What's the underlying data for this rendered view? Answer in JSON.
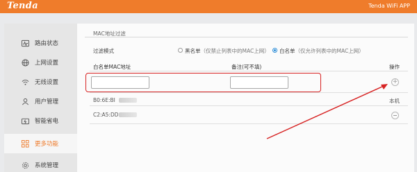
{
  "header": {
    "brand": "Tenda",
    "app_link": "Tenda WiFi APP"
  },
  "sidebar": {
    "items": [
      {
        "label": "路由状态",
        "icon": "pulse-monitor-icon"
      },
      {
        "label": "上网设置",
        "icon": "globe-icon"
      },
      {
        "label": "无线设置",
        "icon": "wifi-icon"
      },
      {
        "label": "用户管理",
        "icon": "user-icon"
      },
      {
        "label": "智能省电",
        "icon": "power-icon"
      },
      {
        "label": "更多功能",
        "icon": "grid-icon",
        "active": true
      },
      {
        "label": "系统管理",
        "icon": "gear-icon"
      }
    ]
  },
  "main": {
    "section_title": "MAC地址过滤",
    "filter_mode_label": "过滤模式",
    "blacklist": {
      "label": "黑名单",
      "hint": "（仅禁止列表中的MAC上网）",
      "selected": false
    },
    "whitelist": {
      "label": "白名单",
      "hint": "（仅允许列表中的MAC上网）",
      "selected": true
    },
    "table": {
      "headers": {
        "mac": "白名单MAC地址",
        "note": "备注(可不填)",
        "action": "操作"
      },
      "new_row": {
        "mac_value": "",
        "note_value": ""
      },
      "rows": [
        {
          "mac": "B0:6E:BI",
          "action": "本机"
        },
        {
          "mac": "C2:A5:DD",
          "action": ""
        }
      ]
    }
  },
  "colors": {
    "accent": "#ef7c2b",
    "highlight": "#d72323",
    "radio": "#2b8cd6"
  }
}
